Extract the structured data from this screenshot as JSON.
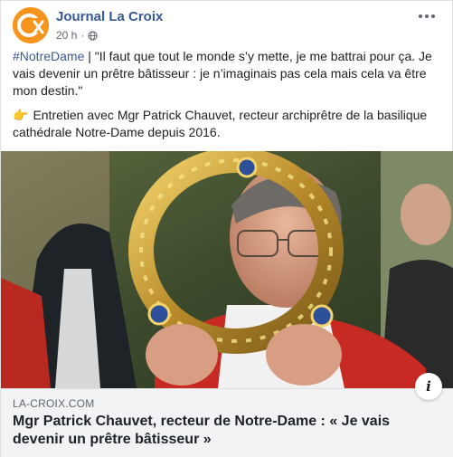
{
  "header": {
    "page_name": "Journal La Croix",
    "time": "20 h",
    "separator": "·",
    "avatar_icon": "la-croix-logo",
    "privacy_icon": "globe-icon",
    "more_icon": "more-options-icon"
  },
  "post": {
    "hashtag": "#NotreDame",
    "quote_text": " | \"Il faut que tout le monde s’y mette, je me battrai pour ça. Je vais devenir un prêtre bâtisseur : je n’imaginais pas cela mais cela va être mon destin.\"",
    "pointing_emoji": "👉",
    "intro_text": "Entretien avec Mgr Patrick Chauvet, recteur archiprêtre de la basilique cathédrale Notre-Dame depuis 2016."
  },
  "link": {
    "domain": "LA-CROIX.COM",
    "title": "Mgr Patrick Chauvet, recteur de Notre-Dame : « Je vais devenir un prêtre bâtisseur »",
    "info_label": "i"
  },
  "colors": {
    "accent": "#385898",
    "logo_orange": "#f7941d",
    "preview_bg": "#f2f3f5"
  }
}
